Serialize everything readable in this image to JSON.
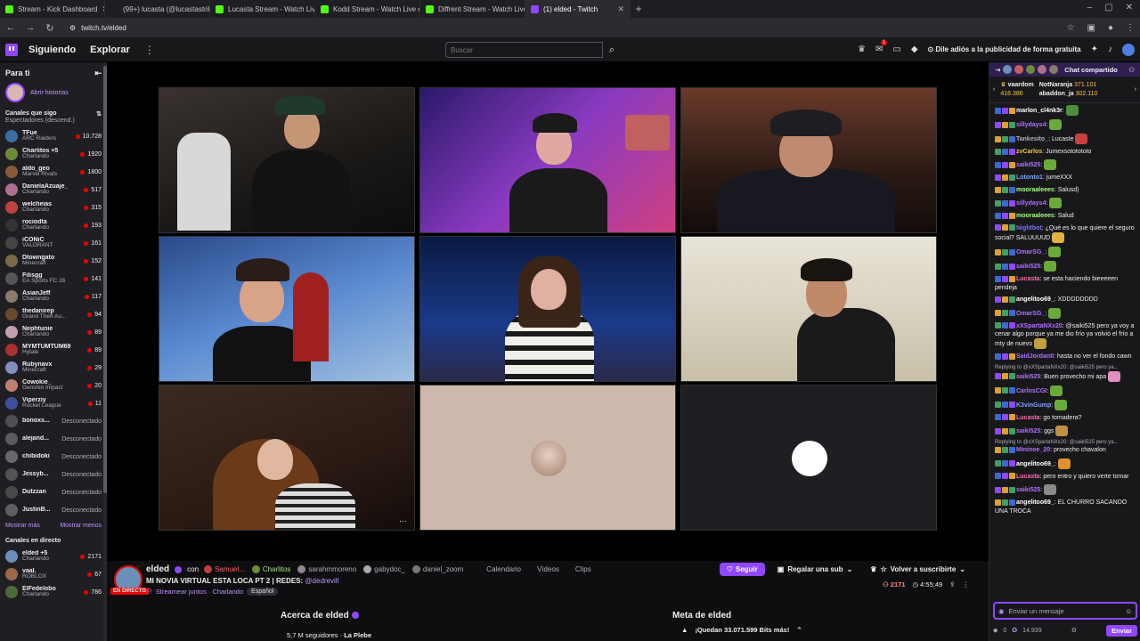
{
  "browser": {
    "tabs": [
      {
        "title": "Stream - Kick Dashboard",
        "color": "#53fc18"
      },
      {
        "title": "(99+) lucasta (@lucastastrike)",
        "color": "#1d1d1d"
      },
      {
        "title": "Lucasta Stream - Watch Live on",
        "color": "#53fc18"
      },
      {
        "title": "Kodd Stream - Watch Live on K",
        "color": "#53fc18"
      },
      {
        "title": "Diffrent Stream - Watch Live on",
        "color": "#53fc18"
      },
      {
        "title": "(1) elded - Twitch",
        "color": "#9147ff"
      }
    ],
    "url": "twitch.tv/elded"
  },
  "topnav": {
    "following": "Siguiendo",
    "browse": "Explorar",
    "search_placeholder": "Buscar",
    "notif_count": "1",
    "adfree": "Dile adiós a la publicidad de forma gratuita"
  },
  "sidebar": {
    "for_you": "Para ti",
    "stories": "Abrir historias",
    "followed_title": "Canales que sigo",
    "followed_sort": "Espectadores (descend.)",
    "channels": [
      {
        "name": "TFue",
        "game": "ARC Raiders",
        "viewers": "10.728",
        "color": "#3a6ea5"
      },
      {
        "name": "Charlitos +5",
        "game": "Charlando",
        "viewers": "1920",
        "color": "#6c8c3a"
      },
      {
        "name": "aldo_geo",
        "game": "Marvel Rivals",
        "viewers": "1800",
        "color": "#8a5a3a"
      },
      {
        "name": "DanielaAzuaje_",
        "game": "Charlando",
        "viewers": "517",
        "color": "#b07090"
      },
      {
        "name": "welcheias",
        "game": "Charlando",
        "viewers": "315",
        "color": "#c04040"
      },
      {
        "name": "rociodta",
        "game": "Charlando",
        "viewers": "193",
        "color": "#333333"
      },
      {
        "name": "iCONiC",
        "game": "VALORANT",
        "viewers": "161",
        "color": "#444444"
      },
      {
        "name": "Dtowngato",
        "game": "Minecraft",
        "viewers": "152",
        "color": "#7a6a4a"
      },
      {
        "name": "Filisgg",
        "game": "EA Sports FC 26",
        "viewers": "141",
        "color": "#555555"
      },
      {
        "name": "AsianJeff",
        "game": "Charlando",
        "viewers": "117",
        "color": "#8a7a6a"
      },
      {
        "name": "thedanirep",
        "game": "Grand Theft Au...",
        "viewers": "94",
        "color": "#6a4a2a"
      },
      {
        "name": "Nephtunie",
        "game": "Charlando",
        "viewers": "89",
        "color": "#c0a0b0"
      },
      {
        "name": "MYMTUMTUM69",
        "game": "Hytale",
        "viewers": "89",
        "color": "#aa3030"
      },
      {
        "name": "Rubynavx",
        "game": "Minecraft",
        "viewers": "29",
        "color": "#8090c0"
      },
      {
        "name": "Cowokie_",
        "game": "Genshin Impact",
        "viewers": "20",
        "color": "#c08070"
      },
      {
        "name": "Viperziy",
        "game": "Rocket League",
        "viewers": "11",
        "color": "#4050a0"
      }
    ],
    "offline": [
      {
        "name": "bonoxs...",
        "status": "Desconectado",
        "color": "#666666"
      },
      {
        "name": "alejand...",
        "status": "Desconectado",
        "color": "#777777"
      },
      {
        "name": "chibidoki",
        "status": "Desconectado",
        "color": "#888888"
      },
      {
        "name": "Jessyb...",
        "status": "Desconectado",
        "color": "#6a6a6a"
      },
      {
        "name": "Dutzzan",
        "status": "Desconectado",
        "color": "#5a5a5a"
      },
      {
        "name": "JustinB...",
        "status": "Desconectado",
        "color": "#7a7a7a"
      }
    ],
    "show_more": "Mostrar más",
    "show_less": "Mostrar menos",
    "live_title": "Canales en directo",
    "live": [
      {
        "name": "elded +5",
        "game": "Charlando",
        "viewers": "2171",
        "color": "#6a8fb8"
      },
      {
        "name": "vaal.",
        "game": "ROBLOX",
        "viewers": "67",
        "color": "#9a6a4a"
      },
      {
        "name": "ElFedelobo",
        "game": "Charlando",
        "viewers": "786",
        "color": "#4a6a3a"
      }
    ]
  },
  "stream": {
    "name": "elded",
    "with": "con",
    "collabs": [
      "Samuel...",
      "Charlitos",
      "sarahmmoreno",
      "gabydoc_",
      "daniel_zoom"
    ],
    "links": [
      "Calendario",
      "Vídeos",
      "Clips"
    ],
    "title": "MI NOVIA VIRTUAL ESTA LOCA PT 2 | REDES:",
    "title_handle": "@dedrevill",
    "live": "EN DIRECTO",
    "category": "Streamear juntos · Charlando",
    "tag": "Español",
    "follow": "Seguir",
    "gift": "Regalar una sub",
    "resub": "Volver a suscribirte",
    "viewers": "2171",
    "uptime": "4:55:49",
    "about": "Acerca de elded",
    "followers": "5,7 M seguidores",
    "team": "La Plebe",
    "goal": "Meta de elded",
    "goal_text": "¡Quedan 33.071.599 Bits más!"
  },
  "chat": {
    "header": "Chat compartido",
    "leaders": [
      {
        "name": "vaardom",
        "value": "416.386"
      },
      {
        "name": "NotNaranja",
        "value": "371.101"
      },
      {
        "name": "abaddon_ja",
        "value": "302.110"
      }
    ],
    "messages": [
      {
        "user": "marlon_cl4nk3r",
        "text": ":",
        "color": "#ffffff",
        "emote": "#4a8f3a"
      },
      {
        "user": "sillydays4",
        "text": ":",
        "color": "#b070ff",
        "emote": "#6aaa3a"
      },
      {
        "user": "Tankesito_",
        "text": ": Lucaste",
        "color": "#adadb8",
        "emote": "#c84040"
      },
      {
        "user": "zvCarlos",
        "text": ": Jumexsototototo",
        "color": "#f4c542",
        "emote": ""
      },
      {
        "user": "saiki525",
        "text": ":",
        "color": "#b070ff",
        "emote": "#6aaa3a"
      },
      {
        "user": "Lotonto1",
        "text": ": jumeXXX",
        "color": "#7fa0ff",
        "emote": ""
      },
      {
        "user": "mooraaleees",
        "text": ": Salusd)",
        "color": "#a0ff80",
        "emote": ""
      },
      {
        "user": "sillydays4",
        "text": ":",
        "color": "#b070ff",
        "emote": "#6aaa3a"
      },
      {
        "user": "mooraaleees",
        "text": ": Salud",
        "color": "#a0ff80",
        "emote": ""
      },
      {
        "user": "Nightbot",
        "text": ": ¿Qué es lo que quiere el seguro social? SALUUUUD",
        "color": "#7f70ff",
        "emote": "#e0b040"
      },
      {
        "user": "OmarSG_",
        "text": ":",
        "color": "#b070ff",
        "emote": "#6aaa3a"
      },
      {
        "user": "saiki525",
        "text": ":",
        "color": "#b070ff",
        "emote": "#6aaa3a"
      },
      {
        "user": "Lucasta",
        "text": ": se esta haciendo bieeeeen pendeja",
        "color": "#ff6ab0",
        "emote": ""
      },
      {
        "user": "angelitoo69_",
        "text": ": XDDDDDDDD",
        "color": "#ffffff",
        "emote": ""
      },
      {
        "user": "OmarSG_",
        "text": ":",
        "color": "#b070ff",
        "emote": "#6aaa3a"
      },
      {
        "user": "xXSpartaNXx20",
        "text": ": @saiki525 pero ya voy a cenar algo porque ya me dio frío ya volvió el frío a mty de nuevo",
        "color": "#b070ff",
        "emote": "#c0a040"
      },
      {
        "user": "SaidJordanII",
        "text": ": hasta no ver el fondo cawn",
        "color": "#b070ff",
        "emote": ""
      },
      {
        "user": "saiki525",
        "text": ": Buen provecho mi apa",
        "color": "#b070ff",
        "emote": "#e090c0",
        "reply": "Replying to @xXSpartaNXx20: @saiki525 pero ya..."
      },
      {
        "user": "CarlosCGI",
        "text": ":",
        "color": "#b070ff",
        "emote": "#6aaa3a"
      },
      {
        "user": "K3vinGump",
        "text": ":",
        "color": "#7fa0ff",
        "emote": "#6aaa3a"
      },
      {
        "user": "Lucasta",
        "text": ": go tomadera?",
        "color": "#ff6ab0",
        "emote": ""
      },
      {
        "user": "saiki525",
        "text": ": ggs",
        "color": "#b070ff",
        "emote": "#c09040"
      },
      {
        "user": "Mininoe_20",
        "text": ": provecho chavalon",
        "color": "#b070ff",
        "emote": "",
        "reply": "Replying to @xXSpartaNXx20: @saiki525 pero ya..."
      },
      {
        "user": "angelitoo69_",
        "text": ":",
        "color": "#ffffff",
        "emote": "#e09030"
      },
      {
        "user": "Lucasta",
        "text": ": pero entro y quiero verte tomar",
        "color": "#ff6ab0",
        "emote": ""
      },
      {
        "user": "saiki525",
        "text": ":",
        "color": "#b070ff",
        "emote": "#8a8a8a"
      },
      {
        "user": "angelitoo69_",
        "text": ": EL CHURRO SACANDO UNA TROCA",
        "color": "#ffffff",
        "emote": ""
      }
    ],
    "input_placeholder": "Enviar un mensaje",
    "points": "14.939",
    "bits": "0",
    "send": "Enviar"
  }
}
